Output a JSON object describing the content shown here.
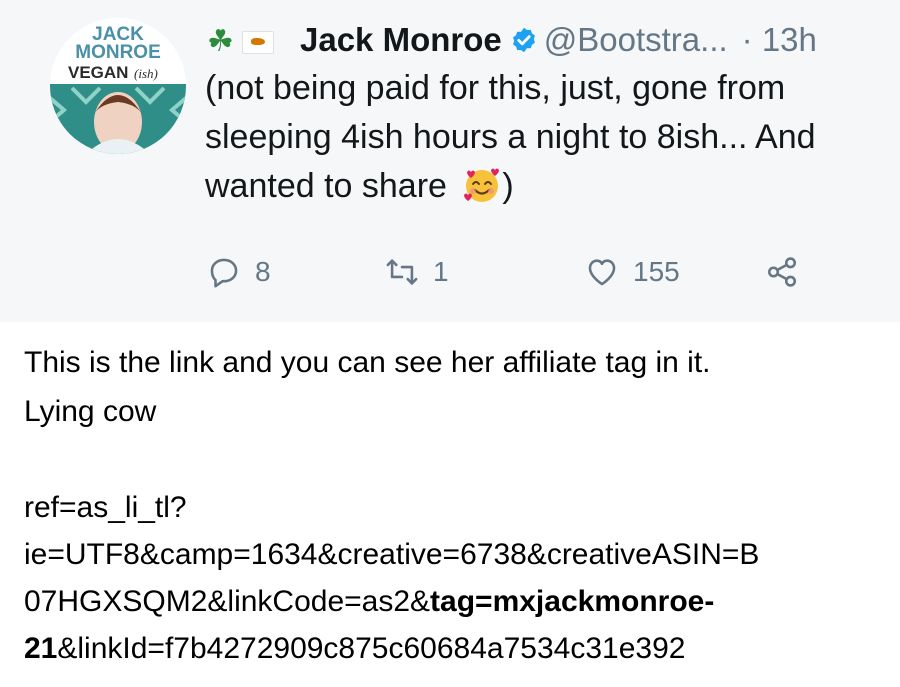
{
  "tweet": {
    "avatar": {
      "brand_line1": "JACK",
      "brand_line2": "MONROE",
      "brand_line3": "VEGAN",
      "brand_suffix": "(ish)"
    },
    "flag_icons": [
      "shamrock-icon",
      "cyprus-flag-icon"
    ],
    "author_name": "Jack Monroe",
    "handle": "@Bootstra...",
    "time": "· 13h",
    "text": "(not being paid for this, just, gone from sleeping 4ish hours a night to 8ish... And wanted to share",
    "text_end": ")",
    "emoji": "smiling-face-with-hearts-icon",
    "actions": {
      "replies": "8",
      "retweets": "1",
      "likes": "155"
    }
  },
  "caption": {
    "line1": "This is the link and you can see her affiliate tag in it.",
    "line2": "Lying cow"
  },
  "url": {
    "line1": "ref=as_li_tl?",
    "line2": "ie=UTF8&camp=1634&creative=6738&creativeASIN=B",
    "line3_plain": "07HGXSQM2&linkCode=as2&",
    "line3_bold": "tag=mxjackmonroe-",
    "line4_bold": "21",
    "line4_plain": "&linkId=f7b4272909c875c60684a7534c31e392"
  },
  "colors": {
    "card_bg": "#f5f7f8",
    "muted": "#657786",
    "verified": "#1da1f2",
    "brand_teal": "#4a90a8"
  }
}
